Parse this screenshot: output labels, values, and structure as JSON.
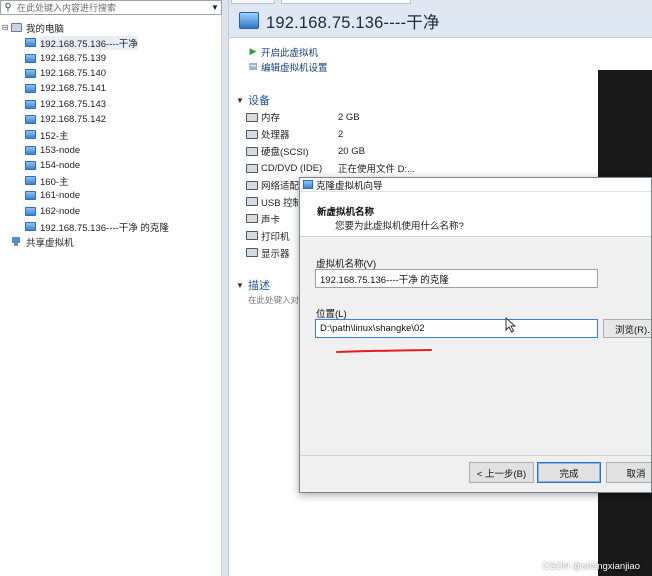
{
  "search": {
    "placeholder": "在此处键入内容进行搜索"
  },
  "library": {
    "root_label": "我的电脑",
    "vms": [
      "192.168.75.136----干净",
      "192.168.75.139",
      "192.168.75.140",
      "192.168.75.141",
      "192.168.75.143",
      "192.168.75.142",
      "152-主",
      "153-node",
      "154-node",
      "160-主",
      "161-node",
      "162-node",
      "192.168.75.136----干净 的克隆"
    ],
    "selected_index": 0,
    "shared_label": "共享虚拟机"
  },
  "vm": {
    "title": "192.168.75.136----干净",
    "actions": {
      "power_on": "开启此虚拟机",
      "edit_settings": "编辑虚拟机设置"
    },
    "devices_heading": "设备",
    "devices": [
      {
        "name": "内存",
        "value": "2 GB"
      },
      {
        "name": "处理器",
        "value": "2"
      },
      {
        "name": "硬盘(SCSI)",
        "value": "20 GB"
      },
      {
        "name": "CD/DVD (IDE)",
        "value": "正在使用文件 D:..."
      },
      {
        "name": "网络适配",
        "value": ""
      },
      {
        "name": "USB 控制",
        "value": ""
      },
      {
        "name": "声卡",
        "value": ""
      },
      {
        "name": "打印机",
        "value": ""
      },
      {
        "name": "显示器",
        "value": ""
      }
    ],
    "description_heading": "描述",
    "description_placeholder": "在此处键入对"
  },
  "dialog": {
    "title": "克隆虚拟机向导",
    "heading": "新虚拟机名称",
    "question": "您要为此虚拟机使用什么名称?",
    "name_label": "虚拟机名称(V)",
    "name_value": "192.168.75.136----干净 的克隆",
    "location_label": "位置(L)",
    "location_value": "D:\\path\\linux\\shangke\\02",
    "browse_label": "浏览(R)...",
    "back_label": "< 上一步(B)",
    "finish_label": "完成",
    "cancel_label": "取消"
  },
  "watermark": "CSDN @shangxianjiao",
  "colors": {
    "accent": "#1d58a0",
    "annotation": "#e02020",
    "console": "#191919"
  }
}
